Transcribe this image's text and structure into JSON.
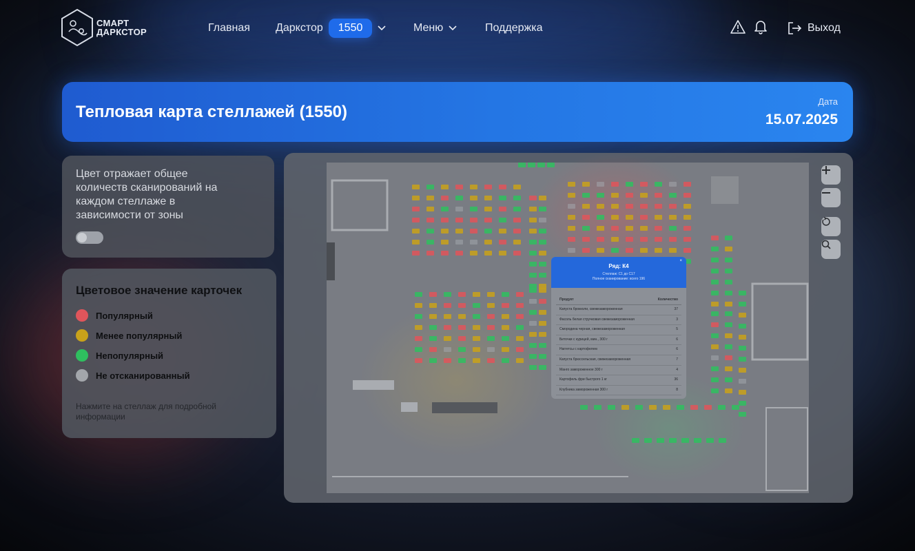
{
  "header": {
    "logo_lines": [
      "СМАРТ",
      "ДАРКСТОР"
    ],
    "nav": {
      "home": "Главная",
      "darkstore": "Даркстор",
      "darkstore_id": "1550",
      "menu": "Меню",
      "support": "Поддержка"
    },
    "icons": [
      "warning-icon",
      "bell-icon",
      "logout-icon"
    ],
    "logout_label": "Выход"
  },
  "banner": {
    "title": "Тепловая карта стеллажей (1550)",
    "date_label": "Дата",
    "date_value": "15.07.2025"
  },
  "info_panel": {
    "description": "Цвет отражает общее количеств сканирований на каждом стеллаже в зависимости от зоны",
    "toggle_on": false
  },
  "legend": {
    "title": "Цветовое значение карточек",
    "items": [
      {
        "label": "Популярный",
        "color": "#e0555b"
      },
      {
        "label": "Менее популярный",
        "color": "#c9a21a"
      },
      {
        "label": "Непопулярный",
        "color": "#2fbf5f"
      },
      {
        "label": "Не отсканированный",
        "color": "#a3a6ab"
      }
    ],
    "hint": "Нажмите на стеллаж для подробной информации"
  },
  "map_controls": [
    "zoom-in-icon",
    "zoom-out-icon",
    "reset-icon",
    "search-icon"
  ],
  "popup": {
    "title": "Ряд: К4",
    "line1": "Стеллаж: С1 до С17",
    "line2": "Полное сканирование: всего 196",
    "columns": [
      "Продукт",
      "Количество"
    ],
    "rows": [
      {
        "name": "Капуста брокколи, свежезамороженная",
        "qty": "37"
      },
      {
        "name": "Фасоль белая стручковая свежезамороженная",
        "qty": "3"
      },
      {
        "name": "Смородина черная, свежезамороженная",
        "qty": "5"
      },
      {
        "name": "Биточки с курицей, мин., 300 г",
        "qty": "6"
      },
      {
        "name": "Наггетсы с картофелем",
        "qty": "6"
      },
      {
        "name": "Капуста брюссельская, свежезамороженная",
        "qty": "7"
      },
      {
        "name": "Манго замороженное 300 г",
        "qty": "4"
      },
      {
        "name": "Картофель фри быстрого 1 кг",
        "qty": "36"
      },
      {
        "name": "Клубника замороженная 300 г",
        "qty": "8"
      }
    ]
  },
  "colors": {
    "accent": "#1f6bea",
    "popular": "#e0555b",
    "less_popular": "#c9a21a",
    "unpopular": "#2fbf5f",
    "not_scanned": "#a3a6ab"
  }
}
